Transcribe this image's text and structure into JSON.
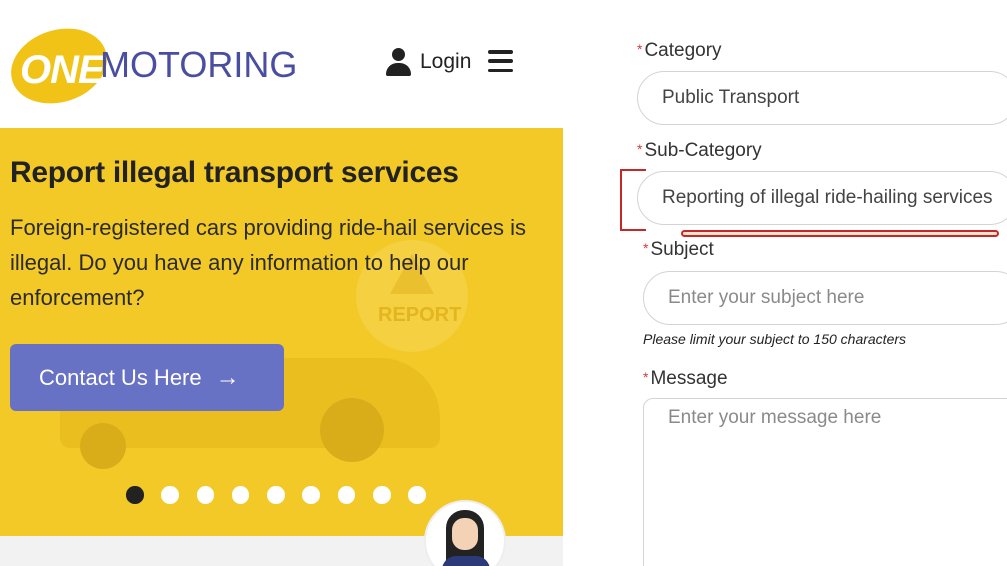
{
  "header": {
    "logo_one": "ONE",
    "logo_motoring": "MOTORING",
    "login_label": "Login"
  },
  "banner": {
    "title": "Report illegal transport services",
    "text": "Foreign-registered cars providing ride-hail services is illegal. Do you have any information to help our enforcement?",
    "button_label": "Contact Us Here",
    "bg_report_text": "REPORT",
    "carousel": {
      "count": 9,
      "active_index": 0
    }
  },
  "form": {
    "category": {
      "label": "Category",
      "value": "Public Transport"
    },
    "subcategory": {
      "label": "Sub-Category",
      "value": "Reporting of illegal ride-hailing services"
    },
    "subject": {
      "label": "Subject",
      "placeholder": "Enter your subject here",
      "hint": "Please limit your subject to 150 characters"
    },
    "message": {
      "label": "Message",
      "placeholder": "Enter your message here"
    },
    "required_mark": "*"
  },
  "colors": {
    "accent_yellow": "#f2c926",
    "button_blue": "#6872c4",
    "logo_purple": "#4a4ea0",
    "annotation_red": "#c62828"
  }
}
